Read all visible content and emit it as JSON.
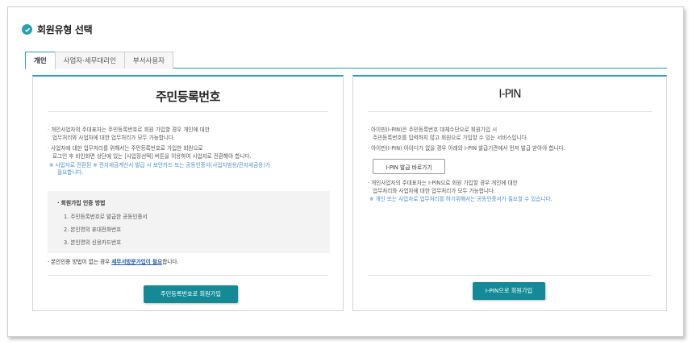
{
  "header": {
    "title": "회원유형 선택"
  },
  "tabs": [
    {
      "label": "개인",
      "active": true
    },
    {
      "label": "사업자·세무대리인",
      "active": false
    },
    {
      "label": "부서사용자",
      "active": false
    }
  ],
  "left": {
    "title": "주민등록번호",
    "lines": [
      "개인사업자의 주대표자는 주민등록번호로 회원 가입할 경우 개인에 대한",
      "업무처리와 사업자에 대한 업무처리가 모두 가능합니다.",
      "사업자에 대한 업무처리를 위해서는 주민등록번호로 가입한 회원으로",
      "로그인 후 비인화면 상단에 있는 [사업장선택] 버튼을 이용하여 사업자로 전환해야 합니다.",
      "※ 사업자로 전환된 ※ 전자세금계산서 발급 시 보안카드 또는 공동인증서(사업자범용/전자세금용)가",
      "필요합니다."
    ],
    "auth": {
      "head": "회원가입 인증 방법",
      "items": [
        "1. 주민등록번호로 발급한 공동인증서",
        "2. 본인명의 휴대전화번호",
        "3. 본인명의 신용카드번호"
      ]
    },
    "footer_prefix": "본인인증 방법이 없는 경우 ",
    "footer_link": "세무서방문가입이 필요",
    "footer_suffix": "합니다.",
    "button": "주민등록번호로 회원가입"
  },
  "right": {
    "title": "I-PIN",
    "lines": [
      "아이핀(I-PIN)은 주민등록번호 대체수단으로 회원가입 시",
      "주민등록번호를 입력하지 않고 회원으로 가입할 수 있는 서비스입니다.",
      "아이핀(I-PIN) 아이디가 없을 경우 아래의 I-PIN 발급기관에서 먼저 발급 받아야 합니다."
    ],
    "issue_button": "I-PIN 발급 바로가기",
    "lines2": [
      "개인사업자의 주대표자는 I-PIN으로 회원 가입할 경우 개인에 대한",
      "업무처리와 사업자에 대한 업무처리가 모두 가능합니다.",
      "※ 개인 또는 사업자로 업무처리를 하기위해서는 공동인증서가 필요할 수 있습니다."
    ],
    "button": "I-PIN으로 회원가입"
  },
  "colors": {
    "accent": "#2a9fb5",
    "button": "#138a96",
    "note": "#4a8fd0"
  }
}
